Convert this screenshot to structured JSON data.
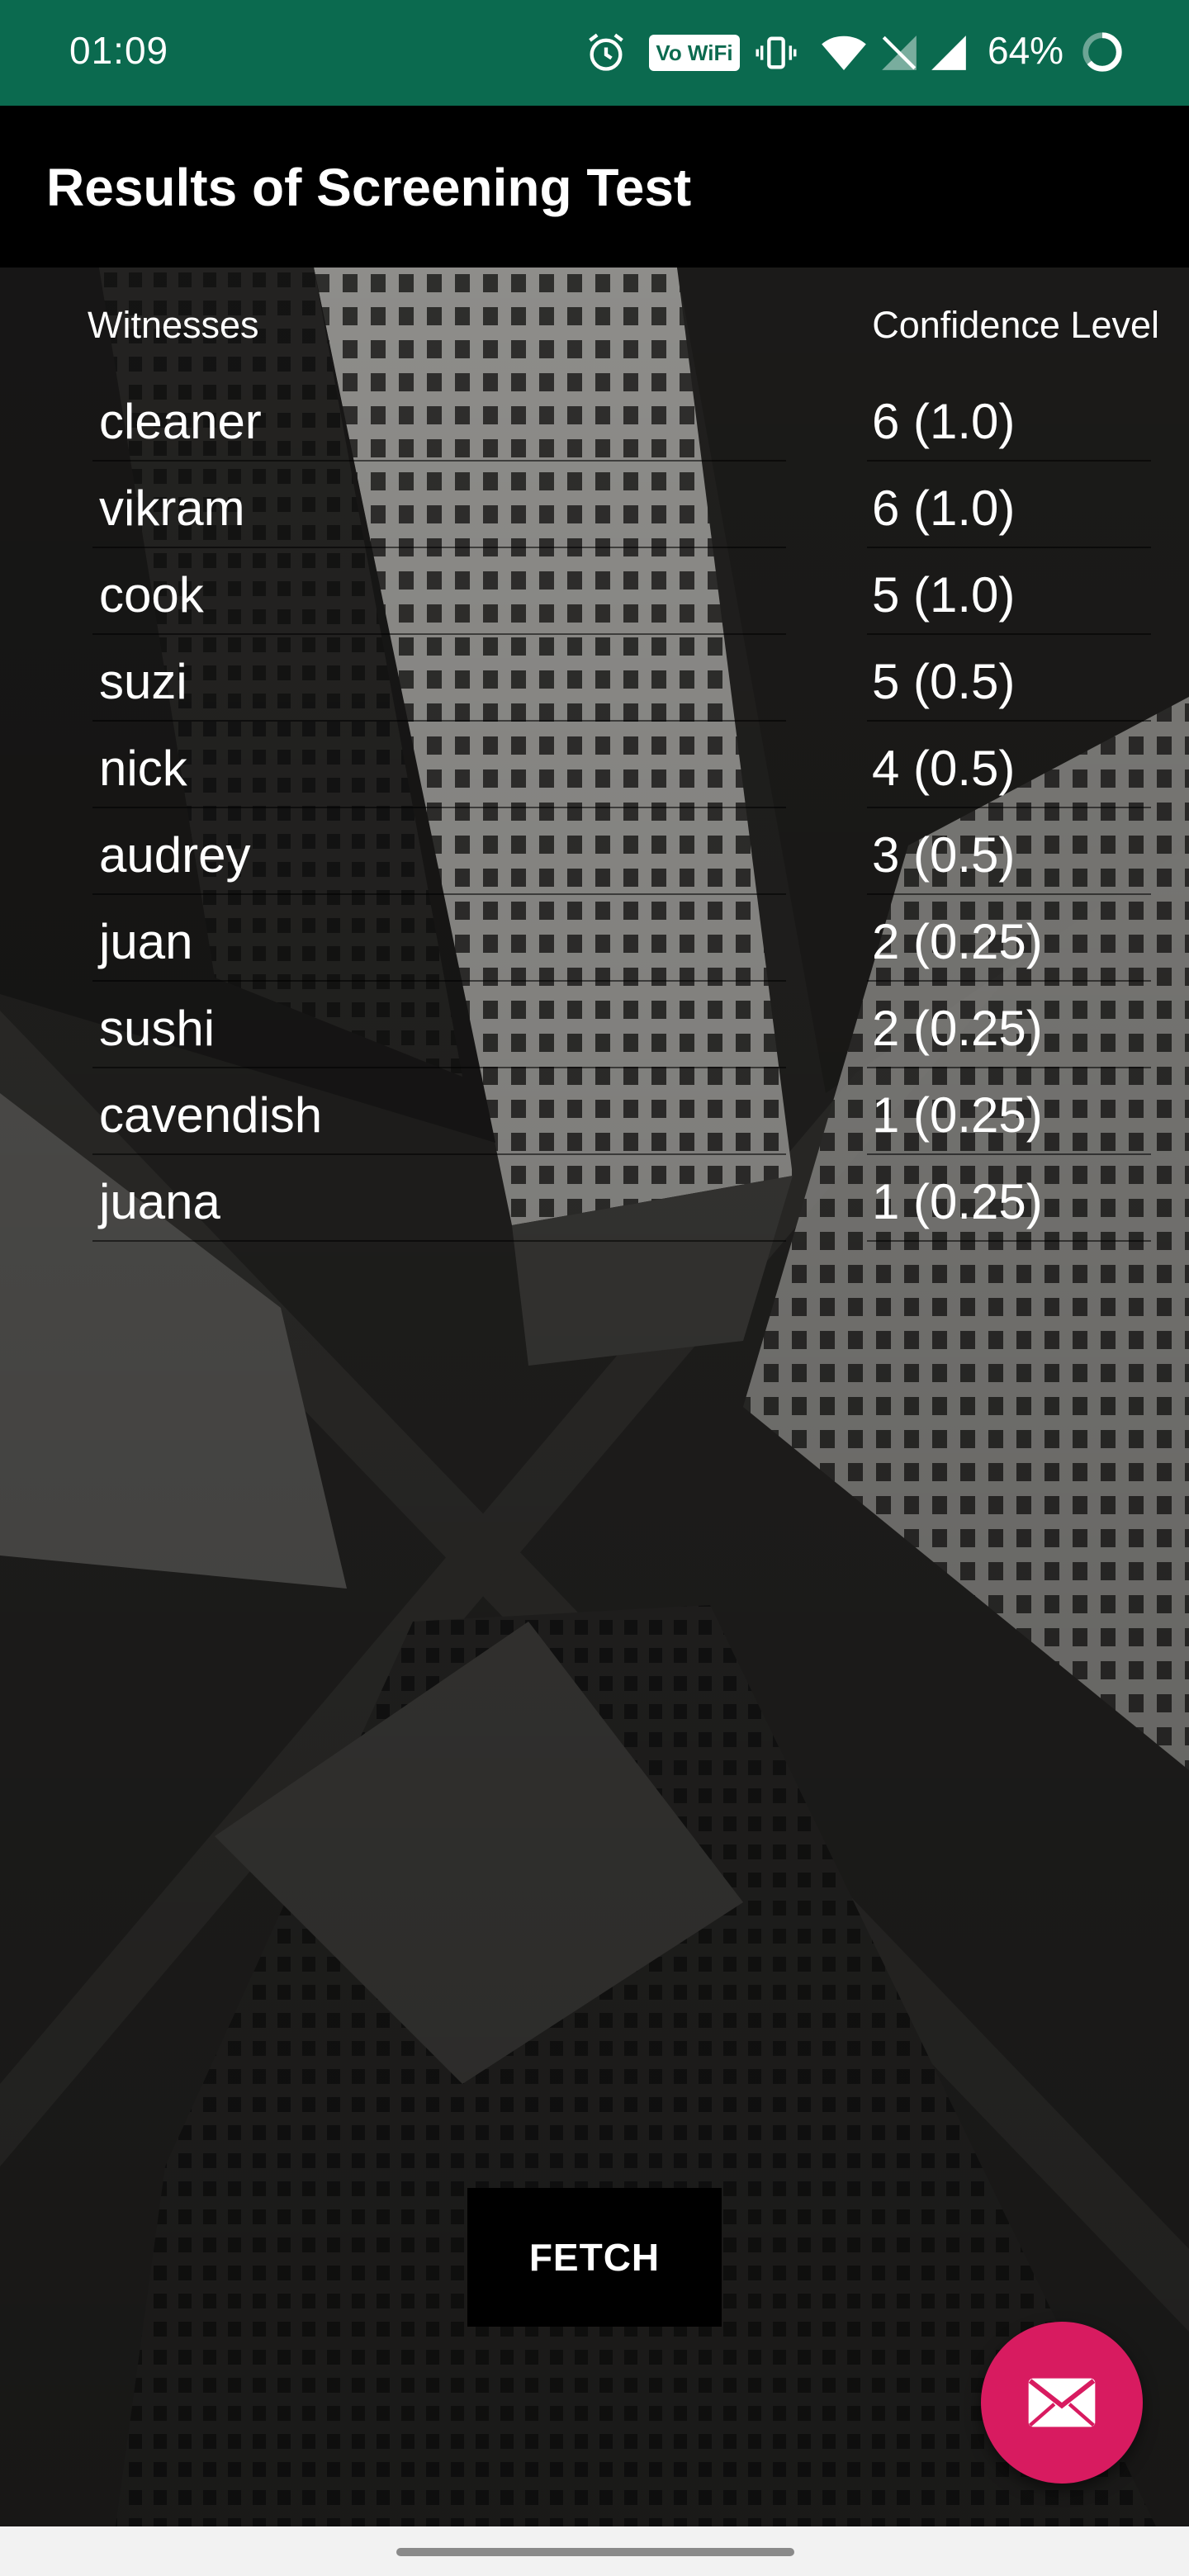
{
  "status_bar": {
    "time": "01:09",
    "wifi_label": "Vo WiFi",
    "battery_text": "64%"
  },
  "app_bar": {
    "title": "Results of Screening Test"
  },
  "table": {
    "headers": {
      "witnesses": "Witnesses",
      "confidence": "Confidence Level"
    },
    "rows": [
      {
        "name": "cleaner",
        "confidence": "6 (1.0)"
      },
      {
        "name": "vikram",
        "confidence": "6 (1.0)"
      },
      {
        "name": "cook",
        "confidence": "5 (1.0)"
      },
      {
        "name": "suzi",
        "confidence": "5 (0.5)"
      },
      {
        "name": "nick",
        "confidence": "4 (0.5)"
      },
      {
        "name": "audrey",
        "confidence": "3 (0.5)"
      },
      {
        "name": "juan",
        "confidence": "2 (0.25)"
      },
      {
        "name": "sushi",
        "confidence": "2 (0.25)"
      },
      {
        "name": "cavendish",
        "confidence": "1 (0.25)"
      },
      {
        "name": "juana",
        "confidence": "1 (0.25)"
      }
    ]
  },
  "fetch_button": {
    "label": "FETCH"
  },
  "fab": {
    "icon": "mail-icon",
    "color": "#d81b60"
  },
  "colors": {
    "status_bar": "#0b6a4f",
    "app_bar": "#000000",
    "text": "#ffffff"
  }
}
